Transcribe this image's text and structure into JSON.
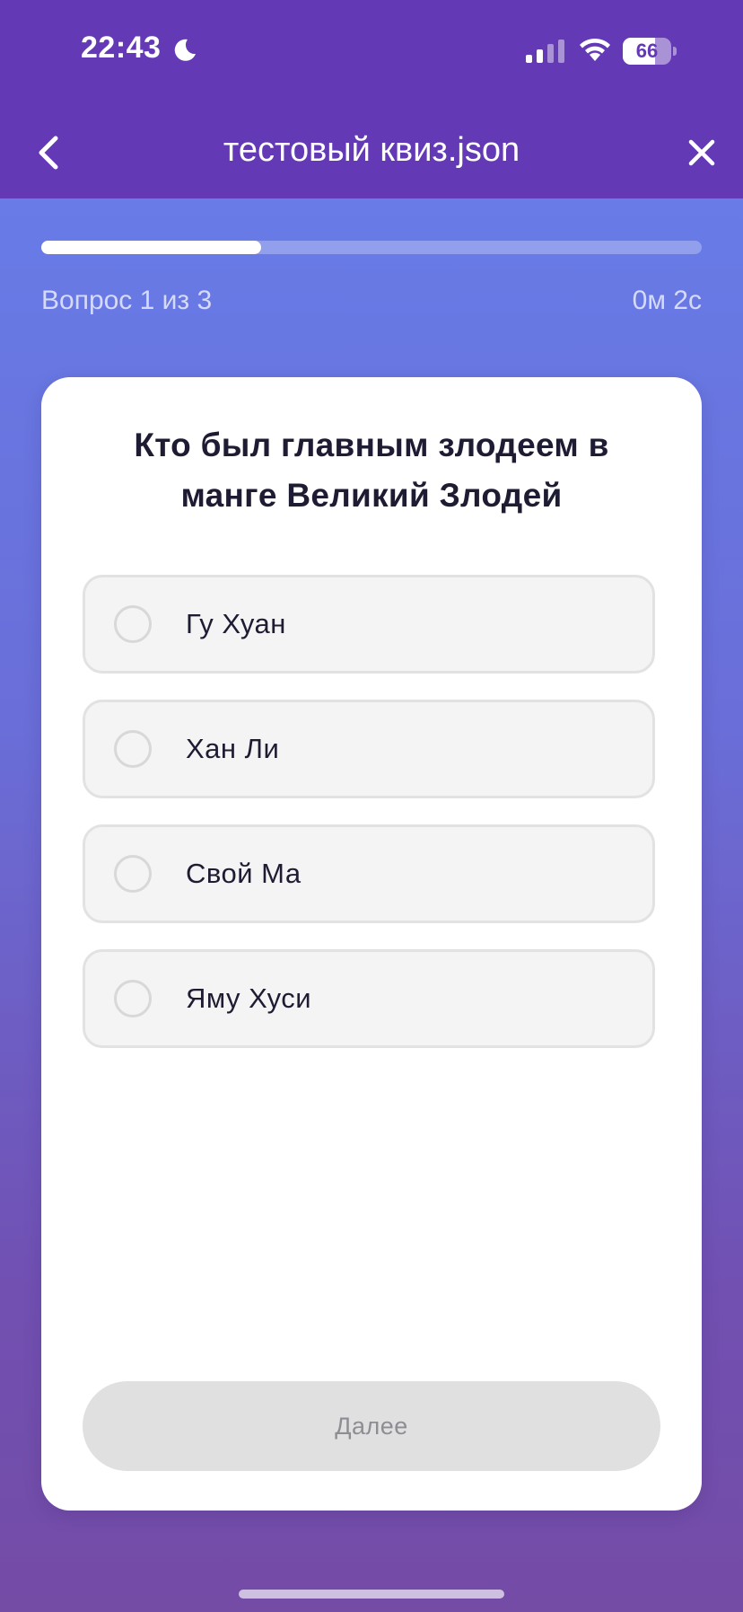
{
  "status_bar": {
    "time": "22:43",
    "battery_level": "66",
    "icons": [
      "moon-icon",
      "signal-icon",
      "wifi-icon",
      "battery-icon"
    ]
  },
  "header": {
    "title": "тестовый квиз.json",
    "back_icon": "chevron-left-icon",
    "close_icon": "close-icon"
  },
  "progress": {
    "fraction": 0.333,
    "counter_text": "Вопрос 1 из 3",
    "timer_text": "0м 2с"
  },
  "question": {
    "text": "Кто был главным злодеем в манге Великий Злодей",
    "options": [
      {
        "label": "Гу Хуан",
        "selected": false
      },
      {
        "label": "Хан Ли",
        "selected": false
      },
      {
        "label": "Свой Ма",
        "selected": false
      },
      {
        "label": "Яму Хуси",
        "selected": false
      }
    ]
  },
  "footer": {
    "next_label": "Далее",
    "next_enabled": false
  },
  "colors": {
    "header_bg": "#6439b6",
    "gradient_top": "#6780ec",
    "gradient_bottom": "#744ca6",
    "option_bg": "#f4f4f4",
    "option_border": "#e2e2e2",
    "button_disabled_bg": "#e0e0e0",
    "button_disabled_text": "#8d8d93",
    "text_dark": "#1e1c33"
  }
}
